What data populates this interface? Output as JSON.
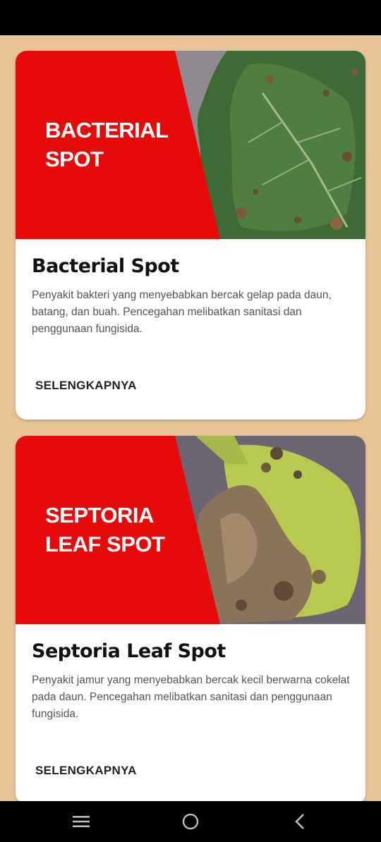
{
  "cards": [
    {
      "banner_title_line1": "BACTERIAL",
      "banner_title_line2": "SPOT",
      "title": "Bacterial Spot",
      "description": "Penyakit bakteri yang menyebabkan bercak gelap pada daun, batang, dan buah. Pencegahan melibatkan sanitasi dan penggunaan fungisida.",
      "action_label": "SELENGKAPNYA"
    },
    {
      "banner_title_line1": "SEPTORIA",
      "banner_title_line2": "LEAF SPOT",
      "title": "Septoria Leaf Spot",
      "description": "Penyakit jamur yang menyebabkan bercak kecil berwarna cokelat pada daun. Pencegahan melibatkan sanitasi dan penggunaan fungisida.",
      "action_label": "SELENGKAPNYA"
    }
  ],
  "nav": {
    "menu_icon": "recent-apps-icon",
    "home_icon": "home-icon",
    "back_icon": "back-icon"
  },
  "colors": {
    "background": "#e8c395",
    "banner_red": "#e60a0a",
    "card": "#ffffff"
  }
}
